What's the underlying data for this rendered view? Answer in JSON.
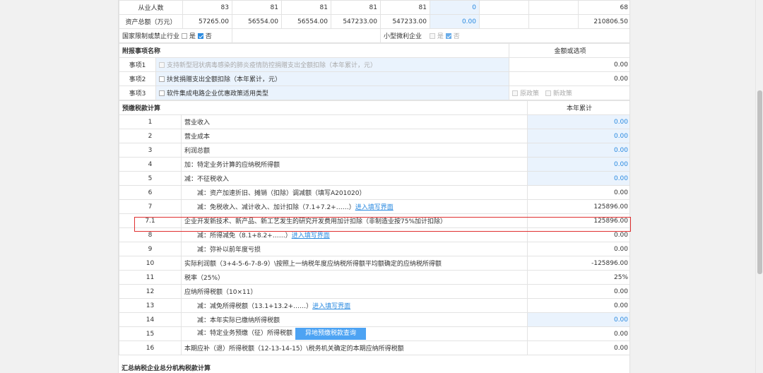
{
  "basic": {
    "employees_label": "从业人数",
    "employees": [
      "83",
      "81",
      "81",
      "81",
      "81",
      "0",
      "",
      "",
      "68"
    ],
    "assets_label": "资产总额（万元）",
    "assets": [
      "57265.00",
      "56554.00",
      "56554.00",
      "547233.00",
      "547233.00",
      "0.00",
      "",
      "",
      "210806.50"
    ],
    "restricted_label": "国家限制或禁止行业",
    "restricted_yes": "是",
    "restricted_no": "否",
    "small_label": "小型微利企业",
    "small_yes": "是",
    "small_no": "否"
  },
  "extra": {
    "header_name": "附报事项名称",
    "header_amount": "金额或选项",
    "items": [
      {
        "label": "事项1",
        "text": "支持新型冠状病毒感染的肺炎疫情防控捐赠支出全额扣除（本年累计，元）",
        "value": "0.00"
      },
      {
        "label": "事项2",
        "text": "扶贫捐赠支出全额扣除（本年累计，元）",
        "value": "0.00"
      },
      {
        "label": "事项3",
        "text": "软件集成电路企业优惠政策适用类型",
        "opt1": "原政策",
        "opt2": "新政策"
      }
    ]
  },
  "prepay": {
    "title": "预缴税款计算",
    "col": "本年累计",
    "link_text": "进入填写界面",
    "button_text": "异地预缴税款查询",
    "rows": [
      {
        "no": "1",
        "text": "营业收入",
        "value": "0.00"
      },
      {
        "no": "2",
        "text": "营业成本",
        "value": "0.00"
      },
      {
        "no": "3",
        "text": "利润总额",
        "value": "0.00"
      },
      {
        "no": "4",
        "text": "加：特定业务计算的应纳税所得额",
        "value": "0.00"
      },
      {
        "no": "5",
        "text": "减：不征税收入",
        "value": "0.00"
      },
      {
        "no": "6",
        "text": "减：资产加速折旧、摊销（扣除）调减额（填写A201020）",
        "value": "0.00"
      },
      {
        "no": "7",
        "text": "减：免税收入、减计收入、加计扣除（7.1+7.2+……）",
        "value": "125896.00"
      },
      {
        "no": "7.1",
        "text": "企业开发新技术、新产品、新工艺发生的研究开发费用加计扣除（非制造业按75%加计扣除）",
        "value": "125896.00"
      },
      {
        "no": "8",
        "text": "减：所得减免（8.1+8.2+……）",
        "value": "0.00"
      },
      {
        "no": "9",
        "text": "减：弥补以前年度亏损",
        "value": "0.00"
      },
      {
        "no": "10",
        "text": "实际利润额（3+4-5-6-7-8-9）\\按照上一纳税年度应纳税所得额平均额确定的应纳税所得额",
        "value": "-125896.00"
      },
      {
        "no": "11",
        "text": "税率（25%）",
        "value": "25%"
      },
      {
        "no": "12",
        "text": "应纳所得税额（10×11）",
        "value": "0.00"
      },
      {
        "no": "13",
        "text": "减：减免所得税额（13.1+13.2+……）",
        "value": "0.00"
      },
      {
        "no": "14",
        "text": "减：本年实际已缴纳所得税额",
        "value": "0.00"
      },
      {
        "no": "15",
        "text": "减：特定业务预缴（征）所得税额",
        "value": "0.00"
      },
      {
        "no": "16",
        "text": "本期应补（退）所得税额（12-13-14-15）\\税务机关确定的本期应纳所得税额",
        "value": "0.00"
      }
    ]
  },
  "footer_section": "汇总纳税企业总分机构税款计算",
  "colors": {
    "accent": "#2a8ae0",
    "highlight": "#e03030",
    "blue_bg": "#eaf3fd"
  }
}
